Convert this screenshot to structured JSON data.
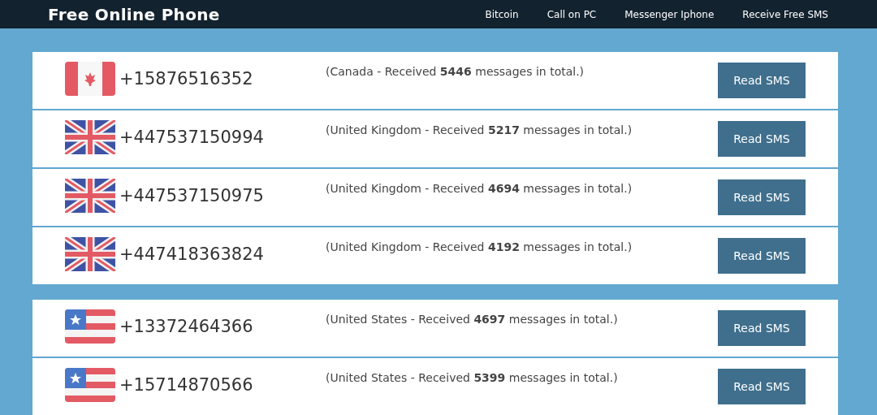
{
  "header": {
    "title": "Free Online Phone",
    "nav": [
      "Bitcoin",
      "Call on PC",
      "Messenger Iphone",
      "Receive Free SMS"
    ]
  },
  "groups": [
    {
      "numbers": [
        {
          "kind": "canada",
          "number": "+15876516352",
          "description": "(Canada - Received **5446** messages in total.)",
          "button": "Read SMS"
        },
        {
          "kind": "uk",
          "number": "+447537150994",
          "description": "(United Kingdom - Received **5217** messages in total.)",
          "button": "Read SMS"
        },
        {
          "kind": "uk",
          "number": "+447537150975",
          "description": "(United Kingdom - Received **4694** messages in total.)",
          "button": "Read SMS"
        },
        {
          "kind": "uk",
          "number": "+447418363824",
          "description": "(United Kingdom - Received **4192** messages in total.)",
          "button": "Read SMS"
        }
      ]
    },
    {
      "numbers": [
        {
          "kind": "us",
          "number": "+13372464366",
          "description": "(United States - Received **4697** messages in total.)",
          "button": "Read SMS"
        },
        {
          "kind": "us",
          "number": "+15714870566",
          "description": "(United States - Received **5399** messages in total.)",
          "button": "Read SMS"
        }
      ]
    }
  ]
}
